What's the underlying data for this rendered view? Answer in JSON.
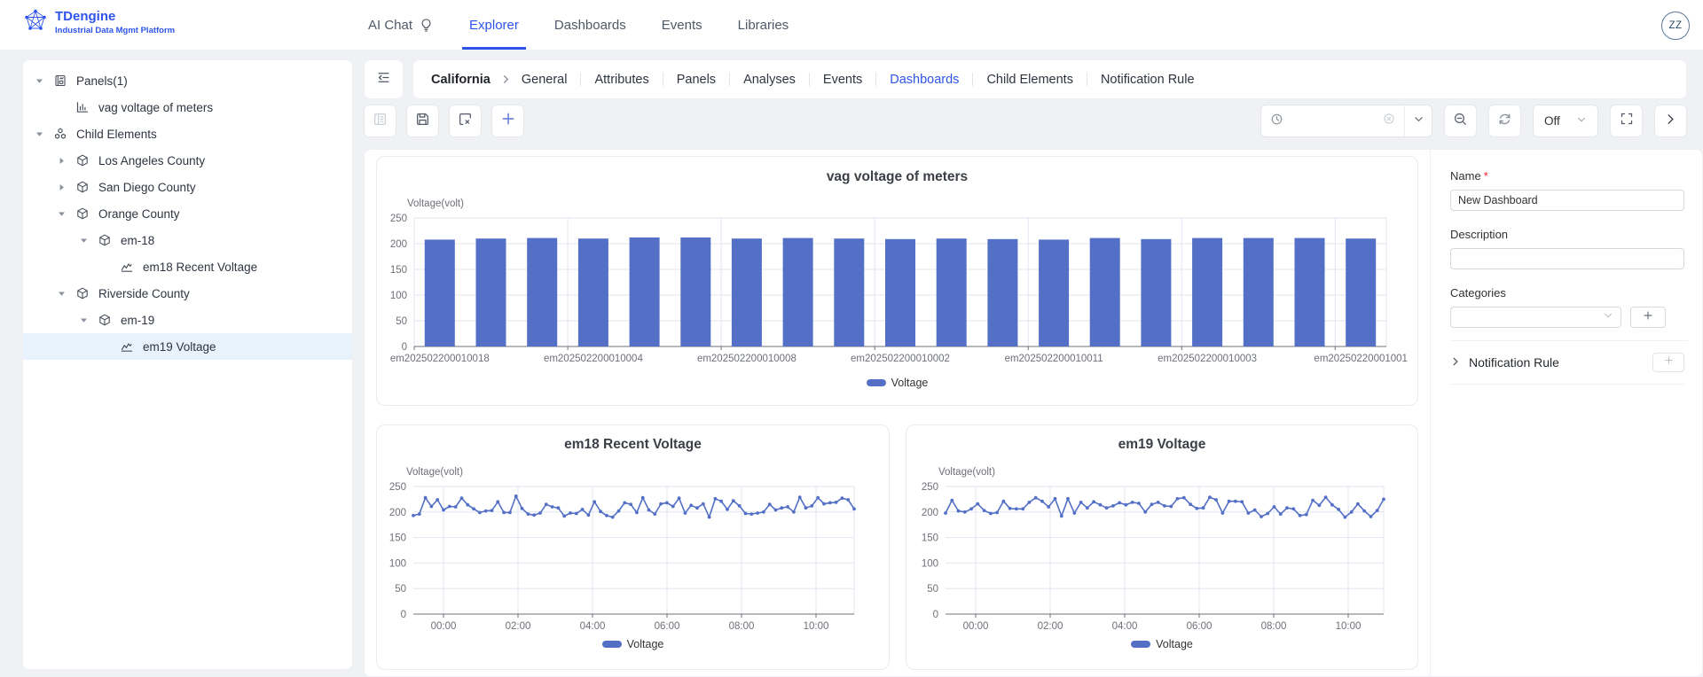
{
  "header": {
    "brand": {
      "title": "TDengine",
      "subtitle": "Industrial Data Mgmt Platform"
    },
    "nav": [
      {
        "label": "AI Chat",
        "icon": "bulb-icon",
        "active": false
      },
      {
        "label": "Explorer",
        "active": true
      },
      {
        "label": "Dashboards",
        "active": false
      },
      {
        "label": "Events",
        "active": false
      },
      {
        "label": "Libraries",
        "active": false
      }
    ],
    "avatar": "ZZ"
  },
  "sidebar": {
    "tree": [
      {
        "label": "Panels(1)",
        "icon": "panel-icon",
        "level": 0,
        "caret": "expanded",
        "selected": false
      },
      {
        "label": "vag voltage of meters",
        "icon": "bar-chart-icon",
        "level": 1,
        "caret": null,
        "selected": false
      },
      {
        "label": "Child Elements",
        "icon": "cluster-icon",
        "level": 0,
        "caret": "expanded",
        "selected": false
      },
      {
        "label": "Los Angeles County",
        "icon": "cube-icon",
        "level": 1,
        "caret": "collapsed",
        "selected": false
      },
      {
        "label": "San Diego County",
        "icon": "cube-icon",
        "level": 1,
        "caret": "collapsed",
        "selected": false
      },
      {
        "label": "Orange County",
        "icon": "cube-icon",
        "level": 1,
        "caret": "expanded",
        "selected": false
      },
      {
        "label": "em-18",
        "icon": "cube-icon",
        "level": 2,
        "caret": "expanded",
        "selected": false
      },
      {
        "label": "em18 Recent Voltage",
        "icon": "line-chart-icon",
        "level": 3,
        "caret": null,
        "selected": false
      },
      {
        "label": "Riverside County",
        "icon": "cube-icon",
        "level": 1,
        "caret": "expanded",
        "selected": false
      },
      {
        "label": "em-19",
        "icon": "cube-icon",
        "level": 2,
        "caret": "expanded",
        "selected": false
      },
      {
        "label": "em19 Voltage",
        "icon": "line-chart-icon",
        "level": 3,
        "caret": null,
        "selected": true
      }
    ]
  },
  "breadcrumb": {
    "root": "California",
    "tabs": [
      {
        "label": "General",
        "active": false
      },
      {
        "label": "Attributes",
        "active": false
      },
      {
        "label": "Panels",
        "active": false
      },
      {
        "label": "Analyses",
        "active": false
      },
      {
        "label": "Events",
        "active": false
      },
      {
        "label": "Dashboards",
        "active": true
      },
      {
        "label": "Child Elements",
        "active": false
      },
      {
        "label": "Notification Rule",
        "active": false
      }
    ]
  },
  "toolbar": {
    "left_icons": [
      "detail-list-icon",
      "save-icon",
      "discard-icon",
      "add-icon"
    ],
    "time_picker": {
      "value": "",
      "icons": [
        "clock-icon",
        "clear-circle-icon",
        "chevron-down-icon"
      ]
    },
    "right_icons": [
      "zoom-out-icon",
      "refresh-icon",
      "fullscreen-icon",
      "next-icon"
    ],
    "refresh_interval_value": "Off"
  },
  "properties": {
    "name_label": "Name",
    "name_value": "New Dashboard",
    "description_label": "Description",
    "description_value": "",
    "categories_label": "Categories",
    "categories_value": "",
    "notification_label": "Notification Rule"
  },
  "chart_data": [
    {
      "type": "bar",
      "title": "vag voltage of meters",
      "ylabel": "Voltage(volt)",
      "legend": "Voltage",
      "series_name": "Voltage",
      "color": "#5470c6",
      "ylim": [
        0,
        250
      ],
      "yticks": [
        0,
        50,
        100,
        150,
        200,
        250
      ],
      "values": [
        208,
        210,
        211,
        210,
        212,
        212,
        210,
        211,
        210,
        209,
        210,
        209,
        208,
        211,
        209,
        211,
        211,
        211,
        210
      ],
      "x_tick_indices": [
        0,
        3,
        6,
        9,
        12,
        15,
        18
      ],
      "x_tick_labels": [
        "em202502200010018",
        "em202502200010004",
        "em202502200010008",
        "em202502200010002",
        "em202502200010011",
        "em202502200010003",
        "em20250220001001"
      ],
      "grid": true,
      "legend_position": "bottom"
    },
    {
      "type": "line",
      "title": "em18 Recent Voltage",
      "ylabel": "Voltage(volt)",
      "legend": "Voltage",
      "series_name": "Voltage",
      "color": "#5470c6",
      "ylim": [
        0,
        250
      ],
      "yticks": [
        0,
        50,
        100,
        150,
        200,
        250
      ],
      "x_ticks": [
        "00:00",
        "02:00",
        "04:00",
        "06:00",
        "08:00",
        "10:00"
      ],
      "values": [
        193,
        196,
        228,
        211,
        224,
        204,
        211,
        210,
        227,
        214,
        206,
        199,
        202,
        203,
        220,
        199,
        199,
        231,
        207,
        196,
        194,
        198,
        215,
        210,
        208,
        192,
        198,
        197,
        205,
        194,
        220,
        201,
        193,
        190,
        202,
        218,
        215,
        199,
        228,
        204,
        196,
        216,
        218,
        211,
        227,
        198,
        213,
        208,
        216,
        190,
        226,
        221,
        205,
        222,
        212,
        197,
        196,
        198,
        200,
        215,
        204,
        208,
        210,
        200,
        229,
        208,
        212,
        228,
        216,
        218,
        219,
        227,
        224,
        206
      ],
      "grid": true,
      "legend_position": "bottom"
    },
    {
      "type": "line",
      "title": "em19 Voltage",
      "ylabel": "Voltage(volt)",
      "legend": "Voltage",
      "series_name": "Voltage",
      "color": "#5470c6",
      "ylim": [
        0,
        250
      ],
      "yticks": [
        0,
        50,
        100,
        150,
        200,
        250
      ],
      "x_ticks": [
        "00:00",
        "02:00",
        "04:00",
        "06:00",
        "08:00",
        "10:00"
      ],
      "values": [
        198,
        223,
        202,
        200,
        206,
        216,
        203,
        197,
        199,
        221,
        207,
        206,
        206,
        219,
        228,
        221,
        210,
        226,
        192,
        226,
        198,
        219,
        208,
        220,
        214,
        208,
        212,
        218,
        214,
        219,
        217,
        200,
        215,
        219,
        212,
        211,
        226,
        228,
        215,
        207,
        208,
        229,
        224,
        198,
        221,
        221,
        220,
        198,
        204,
        191,
        197,
        210,
        196,
        208,
        206,
        193,
        195,
        223,
        213,
        229,
        214,
        205,
        190,
        200,
        216,
        202,
        191,
        203,
        225
      ],
      "grid": true,
      "legend_position": "bottom"
    }
  ]
}
